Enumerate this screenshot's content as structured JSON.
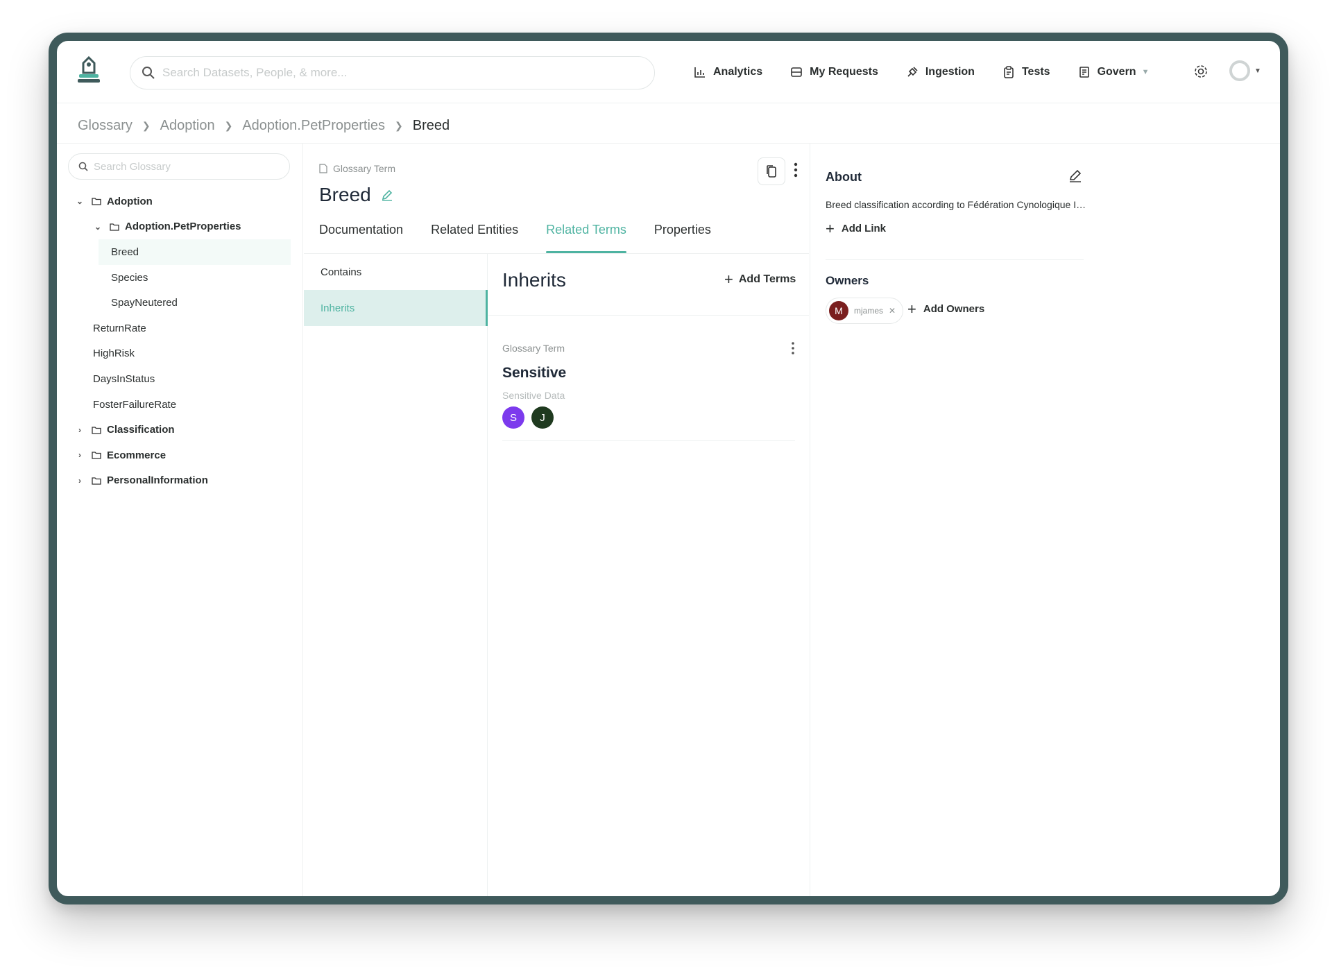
{
  "topbar": {
    "search_placeholder": "Search Datasets, People, & more...",
    "nav": [
      {
        "label": "Analytics",
        "icon": "chart-icon"
      },
      {
        "label": "My Requests",
        "icon": "inbox-icon"
      },
      {
        "label": "Ingestion",
        "icon": "plug-icon"
      },
      {
        "label": "Tests",
        "icon": "clipboard-icon"
      },
      {
        "label": "Govern",
        "icon": "govern-icon"
      }
    ]
  },
  "breadcrumb": [
    "Glossary",
    "Adoption",
    "Adoption.PetProperties",
    "Breed"
  ],
  "sidebar": {
    "search_placeholder": "Search Glossary",
    "tree": [
      {
        "label": "Adoption"
      },
      {
        "label": "Adoption.PetProperties"
      },
      {
        "label": "Breed"
      },
      {
        "label": "Species"
      },
      {
        "label": "SpayNeutered"
      },
      {
        "label": "ReturnRate"
      },
      {
        "label": "HighRisk"
      },
      {
        "label": "DaysInStatus"
      },
      {
        "label": "FosterFailureRate"
      },
      {
        "label": "Classification"
      },
      {
        "label": "Ecommerce"
      },
      {
        "label": "PersonalInformation"
      }
    ]
  },
  "term": {
    "type_label": "Glossary Term",
    "title": "Breed"
  },
  "tabs": [
    "Documentation",
    "Related Entities",
    "Related Terms",
    "Properties"
  ],
  "sublist": [
    "Contains",
    "Inherits"
  ],
  "related": {
    "heading": "Inherits",
    "add_label": "Add Terms",
    "card": {
      "type_label": "Glossary Term",
      "name": "Sensitive",
      "description": "Sensitive Data",
      "avatars": [
        "S",
        "J"
      ]
    }
  },
  "about": {
    "title": "About",
    "description": "Breed classification according to Fédération Cynologique Internationale",
    "add_link": "Add Link"
  },
  "owners": {
    "title": "Owners",
    "owner_initial": "M",
    "owner_name": "mjames",
    "add_label": "Add Owners"
  },
  "colors": {
    "accent": "#4eb3a1",
    "frame": "#3f5a5b",
    "avatar_s": "#7c3aed",
    "avatar_j": "#1f3a1f",
    "avatar_m": "#7a1f1f"
  }
}
